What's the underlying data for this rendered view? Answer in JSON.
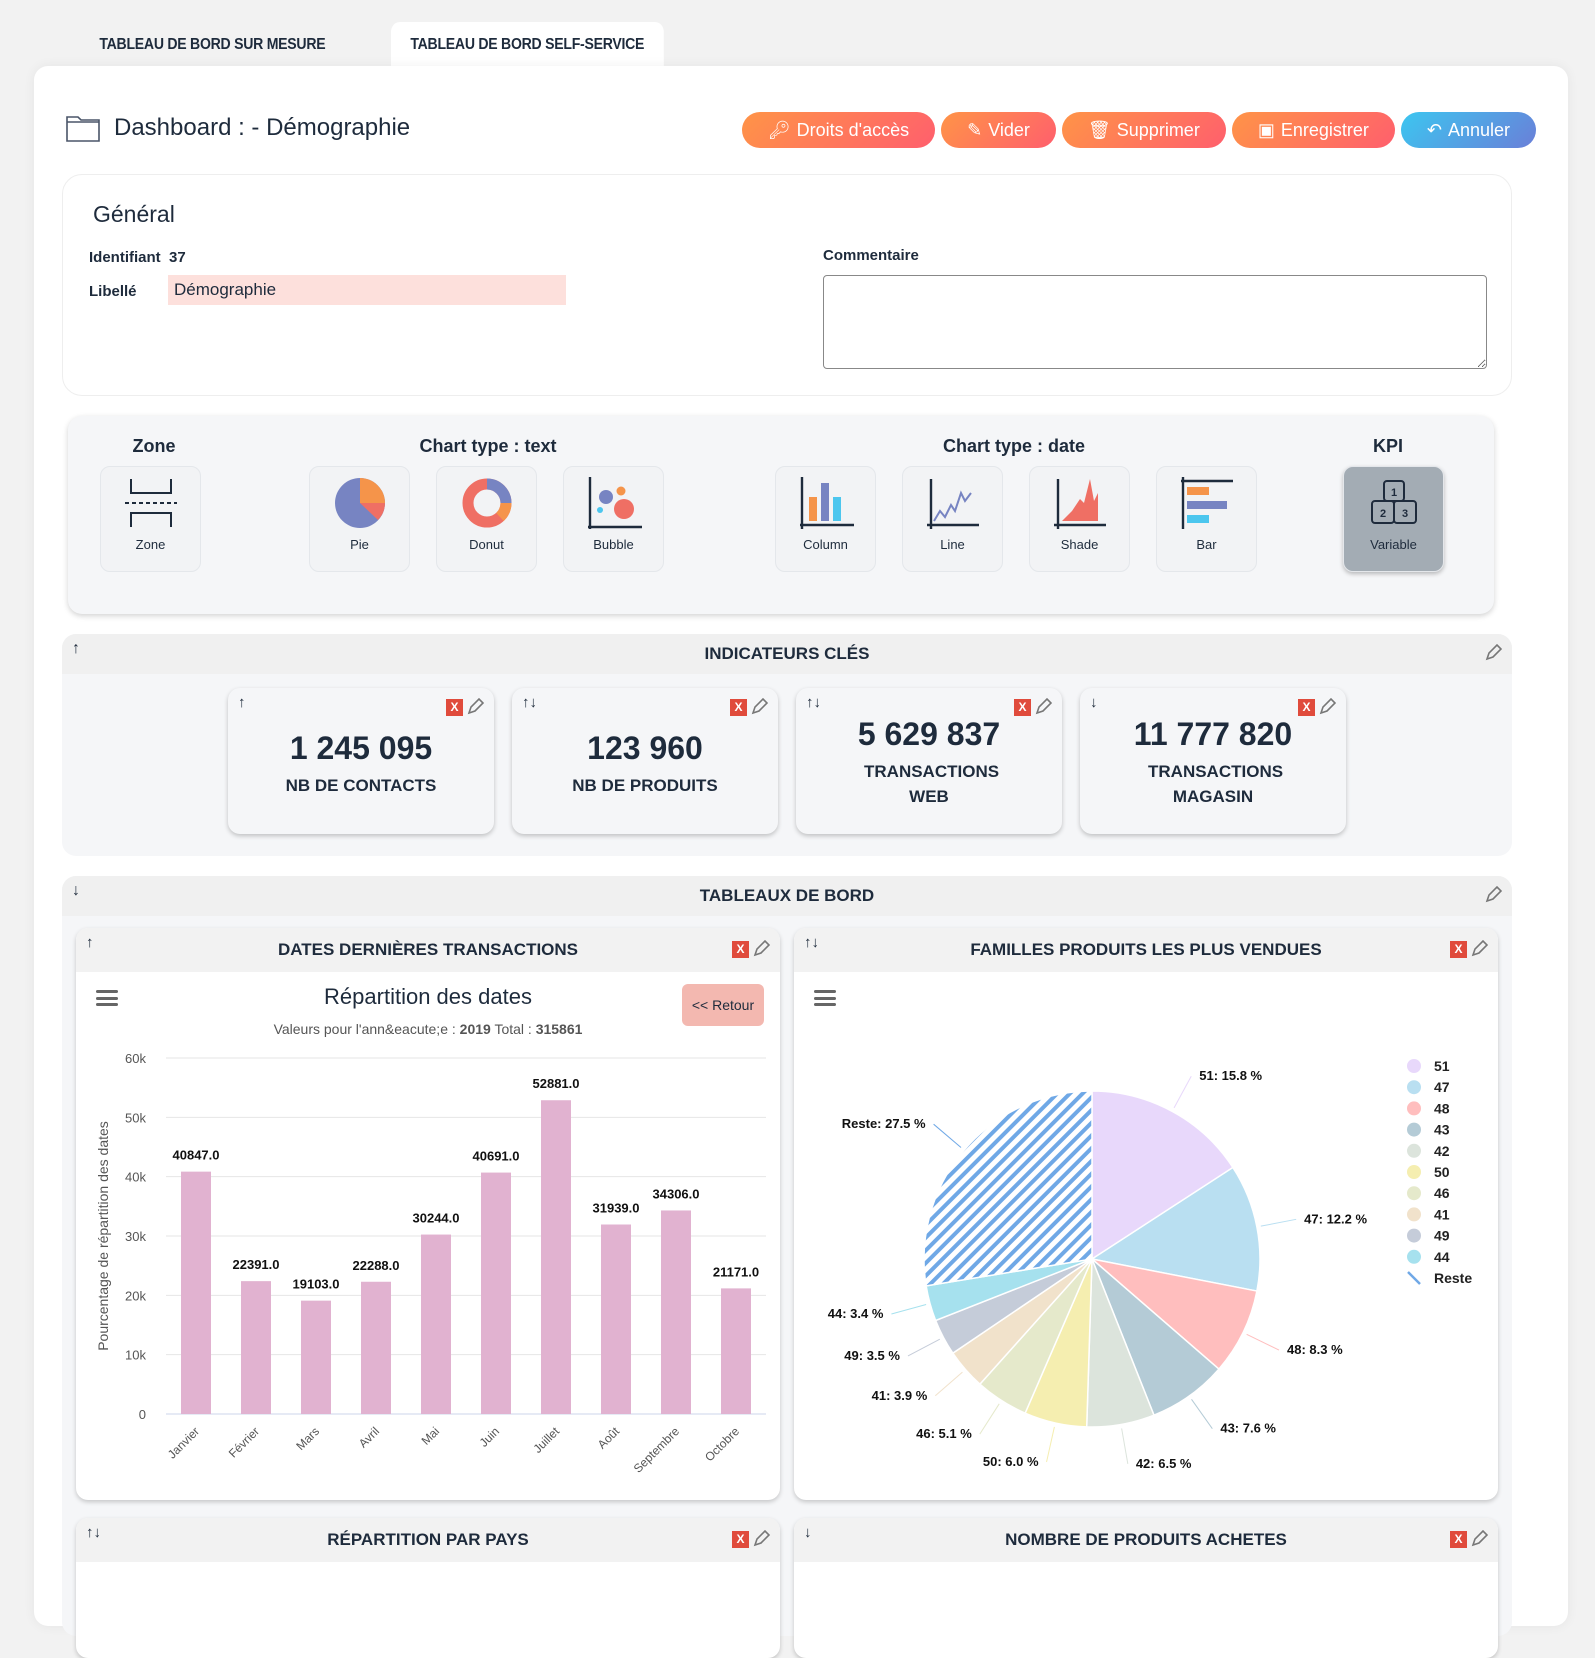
{
  "tabs": [
    {
      "label": "TABLEAU DE BORD SUR MESURE",
      "active": false
    },
    {
      "label": "TABLEAU DE BORD SELF-SERVICE",
      "active": true
    }
  ],
  "header": {
    "title": "Dashboard : - Démographie",
    "buttons": {
      "rights": "Droits d'accès",
      "clear": "Vider",
      "delete": "Supprimer",
      "save": "Enregistrer",
      "cancel": "Annuler"
    }
  },
  "general": {
    "title": "Général",
    "id_label": "Identifiant",
    "id_value": "37",
    "name_label": "Libellé",
    "name_value": "Démographie",
    "comment_label": "Commentaire",
    "comment_value": ""
  },
  "chooser": {
    "groups": {
      "zone": "Zone",
      "text": "Chart type : text",
      "date": "Chart type : date",
      "kpi": "KPI"
    },
    "tiles": {
      "zone": "Zone",
      "pie": "Pie",
      "donut": "Donut",
      "bubble": "Bubble",
      "column": "Column",
      "line": "Line",
      "shade": "Shade",
      "bar": "Bar",
      "variable": "Variable"
    },
    "selected": "variable"
  },
  "kpi_section": {
    "title": "INDICATEURS CLÉS",
    "arrows": "↑",
    "cards": [
      {
        "arrows": "↑",
        "value": "1 245 095",
        "label": "NB DE CONTACTS"
      },
      {
        "arrows": "↑↓",
        "value": "123 960",
        "label": "NB DE PRODUITS"
      },
      {
        "arrows": "↑↓",
        "value": "5 629 837",
        "label": "TRANSACTIONS WEB"
      },
      {
        "arrows": "↓",
        "value": "11 777 820",
        "label": "TRANSACTIONS MAGASIN"
      }
    ]
  },
  "dash_section": {
    "title": "TABLEAUX DE BORD",
    "arrows": "↓",
    "cards": [
      {
        "arrows": "↑",
        "title": "DATES DERNIÈRES TRANSACTIONS"
      },
      {
        "arrows": "↑↓",
        "title": "FAMILLES PRODUITS LES PLUS VENDUES"
      },
      {
        "arrows": "↑↓",
        "title": "RÉPARTITION PAR PAYS"
      },
      {
        "arrows": "↓",
        "title": "NOMBRE DE PRODUITS ACHETES"
      }
    ],
    "delete_label": "X",
    "back_label": "<< Retour"
  },
  "chart_data": [
    {
      "type": "bar",
      "title": "Répartition des dates",
      "subtitle_prefix": "Valeurs pour l'ann&eacute;e : ",
      "subtitle_year": "2019",
      "subtitle_total_label": " Total : ",
      "subtitle_total": "315861",
      "ylabel": "Pourcentage de répartition des dates",
      "xlabel": "",
      "ylim": [
        0,
        60000
      ],
      "yticks": [
        "0",
        "10k",
        "20k",
        "30k",
        "40k",
        "50k",
        "60k"
      ],
      "categories": [
        "Janvier",
        "Février",
        "Mars",
        "Avril",
        "Mai",
        "Juin",
        "Juillet",
        "Août",
        "Septembre",
        "Octobre"
      ],
      "values": [
        40847.0,
        22391.0,
        19103.0,
        22288.0,
        30244.0,
        40691.0,
        52881.0,
        31939.0,
        34306.0,
        21171.0
      ],
      "data_labels": [
        "40847.0",
        "22391.0",
        "19103.0",
        "22288.0",
        "30244.0",
        "40691.0",
        "52881.0",
        "31939.0",
        "34306.0",
        "21171.0"
      ],
      "color": "#e1b2d0",
      "grid": true
    },
    {
      "type": "pie",
      "title": "",
      "legend_position": "right",
      "slices": [
        {
          "name": "51",
          "value": 15.8,
          "label": "51: 15.8 %",
          "color": "#e8d8fb"
        },
        {
          "name": "47",
          "value": 12.2,
          "label": "47: 12.2 %",
          "color": "#b9dff1"
        },
        {
          "name": "48",
          "value": 8.3,
          "label": "48: 8.3 %",
          "color": "#ffbebe"
        },
        {
          "name": "43",
          "value": 7.6,
          "label": "43: 7.6 %",
          "color": "#b4cbd6"
        },
        {
          "name": "42",
          "value": 6.5,
          "label": "42: 6.5 %",
          "color": "#dce4dc"
        },
        {
          "name": "50",
          "value": 6.0,
          "label": "50: 6.0 %",
          "color": "#f5eeb0"
        },
        {
          "name": "46",
          "value": 5.1,
          "label": "46: 5.1 %",
          "color": "#e5e9cb"
        },
        {
          "name": "41",
          "value": 3.9,
          "label": "41: 3.9 %",
          "color": "#f1e2cb"
        },
        {
          "name": "49",
          "value": 3.5,
          "label": "49: 3.5 %",
          "color": "#c5ccd9"
        },
        {
          "name": "44",
          "value": 3.4,
          "label": "44: 3.4 %",
          "color": "#a6e1ee"
        },
        {
          "name": "Reste",
          "value": 27.5,
          "label": "Reste: 27.5 %",
          "color": "#6fa8e6",
          "pattern": "hatch"
        }
      ]
    }
  ]
}
